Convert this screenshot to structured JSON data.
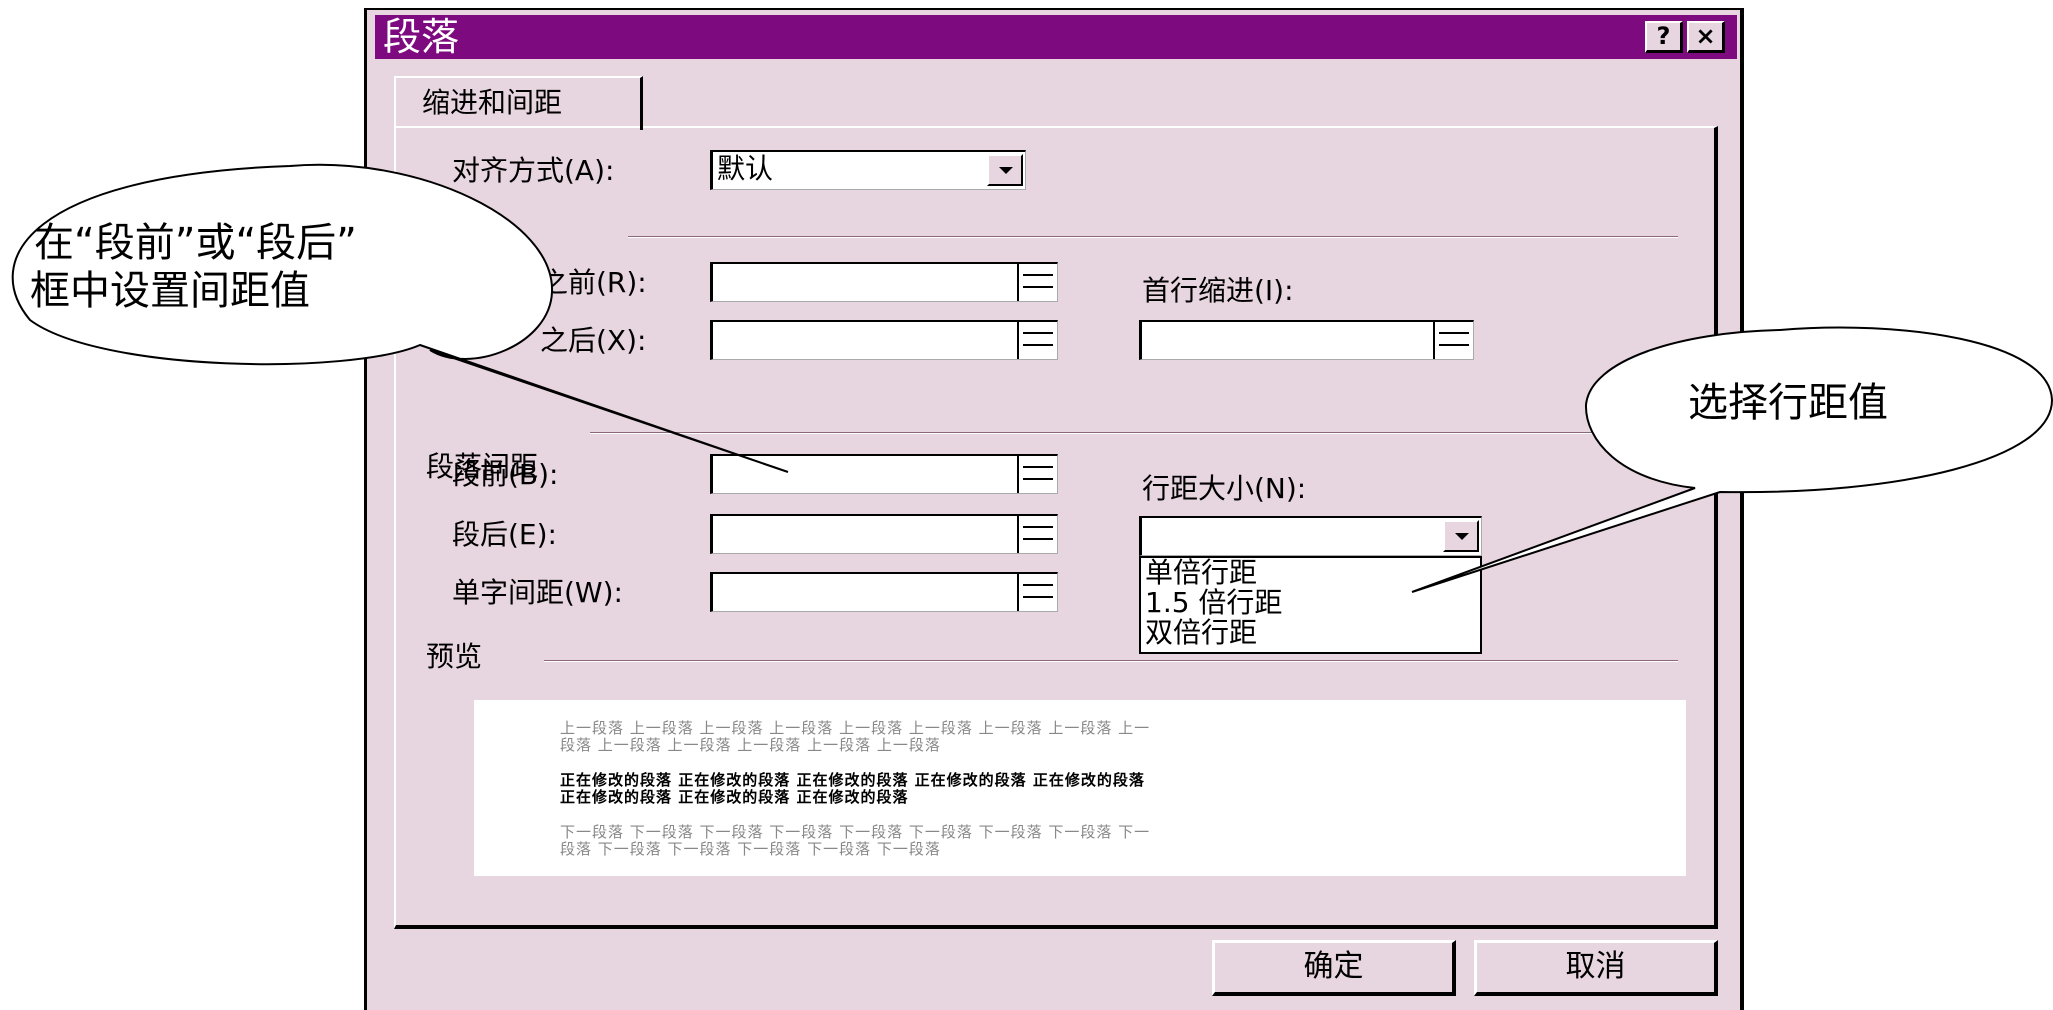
{
  "dialog": {
    "title": "段落",
    "help_label": "?",
    "close_label": "×",
    "tab_label": "缩进和间距",
    "align": {
      "label": "对齐方式(A):",
      "value": "默认"
    },
    "indent": {
      "before_label": "之前(R):",
      "after_label": "之后(X):",
      "first_line_label": "首行缩进(I):"
    },
    "spacing": {
      "section_label": "段落间距",
      "before_label": "段前(B):",
      "after_label": "段后(E):",
      "char_spacing_label": "单字间距(W):",
      "line_spacing_label": "行距大小(N):",
      "line_spacing_options": [
        "单倍行距",
        "1.5 倍行距",
        "双倍行距"
      ]
    },
    "preview": {
      "label": "预览",
      "prev_lines": [
        "上一段落 上一段落 上一段落 上一段落 上一段落 上一段落 上一段落 上一段落 上一",
        "段落 上一段落 上一段落 上一段落 上一段落 上一段落"
      ],
      "current_lines": [
        "正在修改的段落 正在修改的段落 正在修改的段落 正在修改的段落 正在修改的段落",
        "正在修改的段落 正在修改的段落 正在修改的段落"
      ],
      "next_lines": [
        "下一段落 下一段落 下一段落 下一段落 下一段落 下一段落 下一段落 下一段落 下一",
        "段落 下一段落 下一段落 下一段落 下一段落 下一段落"
      ]
    },
    "ok_label": "确定",
    "cancel_label": "取消"
  },
  "callouts": {
    "left_lines": [
      "在“段前”或“段后”",
      "框中设置间距值"
    ],
    "right_text": "选择行距值"
  }
}
